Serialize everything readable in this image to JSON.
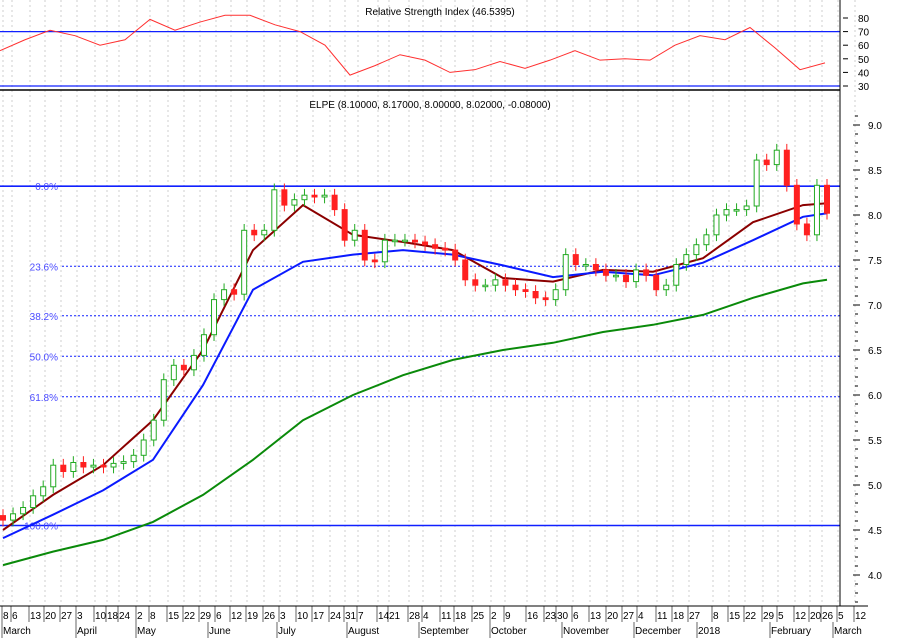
{
  "chart_data": [
    {
      "type": "line",
      "title": "Relative Strength Index (46.5395)",
      "ylim": [
        25,
        85
      ],
      "y_ticks": [
        "80",
        "70",
        "60",
        "50",
        "40",
        "30"
      ],
      "reference_lines": [
        70,
        30
      ],
      "series": [
        {
          "name": "RSI",
          "color": "#ff3030",
          "values": [
            56,
            64,
            71,
            67,
            60,
            64,
            79,
            71,
            77,
            82,
            82,
            75,
            70,
            60,
            38,
            45,
            53,
            49,
            40,
            42,
            48,
            43,
            49,
            56,
            49,
            50,
            49,
            60,
            67,
            64,
            73,
            58,
            42,
            47
          ]
        }
      ]
    },
    {
      "type": "candlestick",
      "title": "ELPE (8.10000, 8.17000, 8.00000, 8.02000, -0.08000)",
      "ylim": [
        3.6,
        9.2
      ],
      "y_ticks": [
        "9.0",
        "8.5",
        "8.0",
        "7.5",
        "7.0",
        "6.5",
        "6.0",
        "5.5",
        "5.0",
        "4.5",
        "4.0"
      ],
      "closes": [
        4.61,
        4.68,
        4.75,
        4.88,
        4.98,
        5.22,
        5.15,
        5.25,
        5.2,
        5.22,
        5.2,
        5.24,
        5.26,
        5.33,
        5.5,
        5.72,
        6.17,
        6.33,
        6.28,
        6.44,
        6.67,
        7.06,
        7.17,
        7.12,
        7.83,
        7.78,
        7.83,
        8.28,
        8.11,
        8.17,
        8.22,
        8.2,
        8.22,
        8.06,
        7.72,
        7.83,
        7.5,
        7.48,
        7.72,
        7.72,
        7.72,
        7.7,
        7.67,
        7.63,
        7.61,
        7.5,
        7.28,
        7.22,
        7.22,
        7.28,
        7.22,
        7.17,
        7.15,
        7.08,
        7.06,
        7.17,
        7.56,
        7.45,
        7.45,
        7.39,
        7.33,
        7.33,
        7.26,
        7.39,
        7.33,
        7.17,
        7.22,
        7.45,
        7.56,
        7.67,
        7.78,
        8.0,
        8.06,
        8.06,
        8.1,
        8.61,
        8.56,
        8.72,
        8.33,
        7.9,
        7.78,
        8.33,
        8.02
      ],
      "moving_averages": [
        {
          "name": "short MA",
          "color": "#8b0000",
          "values": [
            4.5,
            4.89,
            5.22,
            5.72,
            6.5,
            7.61,
            8.11,
            7.78,
            7.7,
            7.61,
            7.3,
            7.26,
            7.39,
            7.37,
            7.52,
            7.92,
            8.11,
            8.13
          ]
        },
        {
          "name": "medium MA",
          "color": "#0a1aff",
          "values": [
            4.41,
            4.67,
            4.94,
            5.28,
            6.11,
            7.17,
            7.48,
            7.56,
            7.61,
            7.56,
            7.44,
            7.31,
            7.37,
            7.33,
            7.47,
            7.72,
            7.98,
            8.02
          ]
        },
        {
          "name": "long MA",
          "color": "#0a8a0a",
          "values": [
            4.11,
            4.26,
            4.39,
            4.59,
            4.89,
            5.28,
            5.72,
            6.0,
            6.22,
            6.39,
            6.5,
            6.58,
            6.7,
            6.78,
            6.89,
            7.08,
            7.24,
            7.28
          ]
        }
      ],
      "fibonacci": [
        {
          "label": "0.0%",
          "price": 8.32,
          "solid": true
        },
        {
          "label": "23.6%",
          "price": 7.43,
          "solid": false
        },
        {
          "label": "38.2%",
          "price": 6.88,
          "solid": false
        },
        {
          "label": "50.0%",
          "price": 6.43,
          "solid": false
        },
        {
          "label": "61.8%",
          "price": 5.98,
          "solid": false
        },
        {
          "label": "100.0%",
          "price": 4.55,
          "solid": true
        }
      ],
      "up_color": "#22aa22",
      "down_color": "#ff2020"
    }
  ],
  "x_axis": {
    "day_ticks": [
      "8",
      "6",
      "13",
      "20",
      "27",
      "3",
      "10",
      "18",
      "24",
      "2",
      "8",
      "15",
      "22",
      "29",
      "6",
      "12",
      "19",
      "26",
      "3",
      "10",
      "17",
      "24",
      "31",
      "7",
      "14",
      "21",
      "28",
      "4",
      "11",
      "18",
      "25",
      "2",
      "9",
      "16",
      "23",
      "30",
      "6",
      "13",
      "20",
      "27",
      "4",
      "11",
      "18",
      "27",
      "8",
      "15",
      "22",
      "29",
      "5",
      "12",
      "20",
      "26",
      "5",
      "12"
    ],
    "months": [
      "March",
      "April",
      "May",
      "June",
      "July",
      "August",
      "September",
      "October",
      "November",
      "December",
      "2018",
      "February",
      "March"
    ]
  }
}
